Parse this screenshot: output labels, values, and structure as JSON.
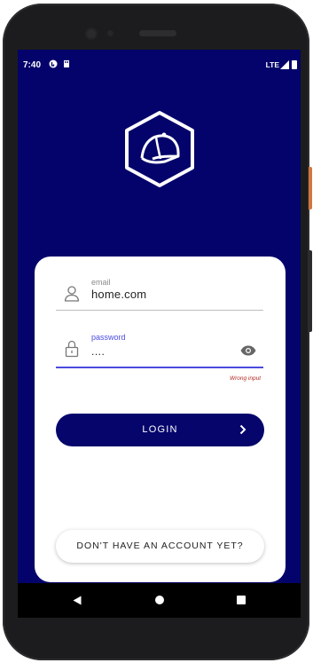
{
  "statusbar": {
    "time": "7:40",
    "network": "LTE"
  },
  "logo": {
    "icon": "baseball-cap-hexagon-logo"
  },
  "form": {
    "email": {
      "label": "email",
      "value": "home.com",
      "icon": "user-icon"
    },
    "password": {
      "label": "password",
      "value": "....",
      "icon": "lock-icon",
      "toggle_icon": "eye-icon"
    },
    "error": "Wrong input",
    "login_label": "LOGIN",
    "signup_label": "DON'T HAVE AN ACCOUNT YET?"
  },
  "colors": {
    "background": "#03036b",
    "primary": "#05056c",
    "focus": "#4b4bdf",
    "error": "#b3261e"
  },
  "navbar": {
    "items": [
      "back-icon",
      "home-icon",
      "recents-icon"
    ]
  }
}
